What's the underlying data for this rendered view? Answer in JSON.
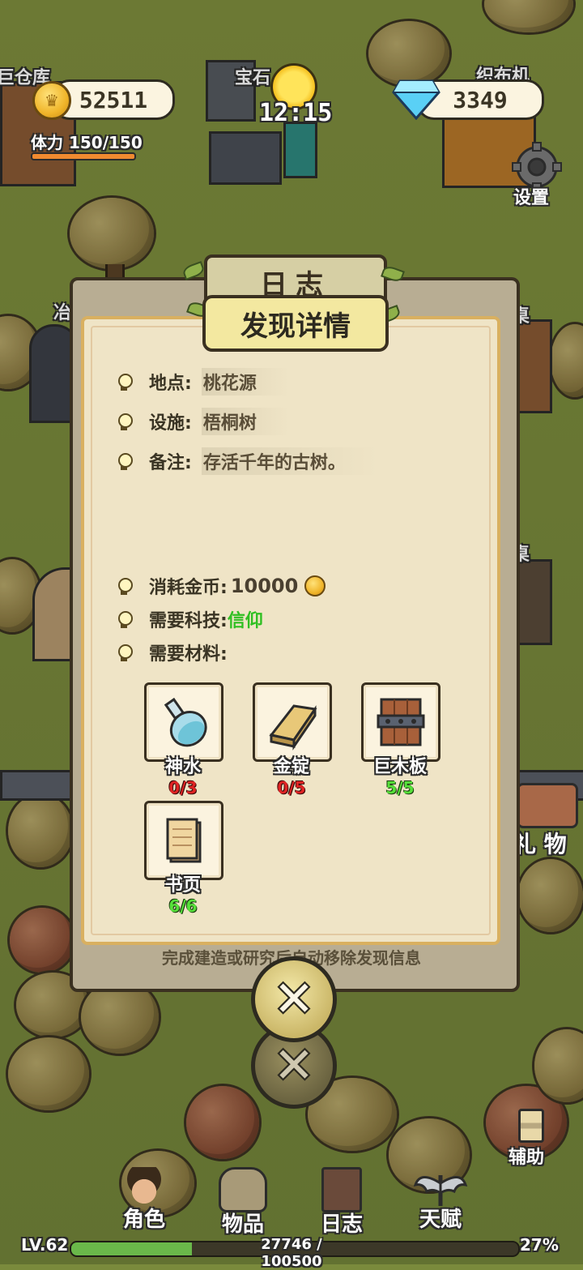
{
  "hud": {
    "coins": "52511",
    "gems": "3349",
    "time": "12:15",
    "stamina": "体力 150/150",
    "settings_label": "设置",
    "colors": {
      "accent": "#f3e8a0",
      "green": "#2fbf22",
      "red": "#e02424"
    }
  },
  "map_labels": {
    "warehouse": "巨仓库",
    "gem": "宝石",
    "loom": "织布机",
    "smelt": "冶",
    "bench1": "桌",
    "bench2": "桌",
    "gift": "礼 物",
    "assist": "辅助"
  },
  "dialog": {
    "back_title": "日志",
    "title": "发现详情",
    "fields": [
      {
        "label": "地点:",
        "value": "桃花源"
      },
      {
        "label": "设施:",
        "value": "梧桐树"
      },
      {
        "label": "备注:",
        "value": "存活千年的古树。"
      }
    ],
    "cost_label": "消耗金币:",
    "cost_value": "10000",
    "tech_label": "需要科技:",
    "tech_value": "信仰",
    "materials_label": "需要材料:",
    "materials": [
      {
        "name": "神水",
        "count": "0/3",
        "icon": "potion-flask",
        "status": "insufficient"
      },
      {
        "name": "金锭",
        "count": "0/5",
        "icon": "gold-ingot",
        "status": "insufficient"
      },
      {
        "name": "巨木板",
        "count": "5/5",
        "icon": "wood-plank",
        "status": "complete"
      },
      {
        "name": "书页",
        "count": "6/6",
        "icon": "book-page",
        "status": "complete"
      }
    ],
    "footer_note": "完成建造或研究后自动移除发现信息"
  },
  "nav": [
    {
      "label": "角色",
      "icon": "character-icon"
    },
    {
      "label": "物品",
      "icon": "backpack-icon"
    },
    {
      "label": "日志",
      "icon": "journal-icon"
    },
    {
      "label": "天赋",
      "icon": "wings-icon"
    }
  ],
  "level": {
    "level_text": "LV.62",
    "exp_text": "27746 / 100500",
    "percent_text": "27%",
    "progress": 0.27
  }
}
